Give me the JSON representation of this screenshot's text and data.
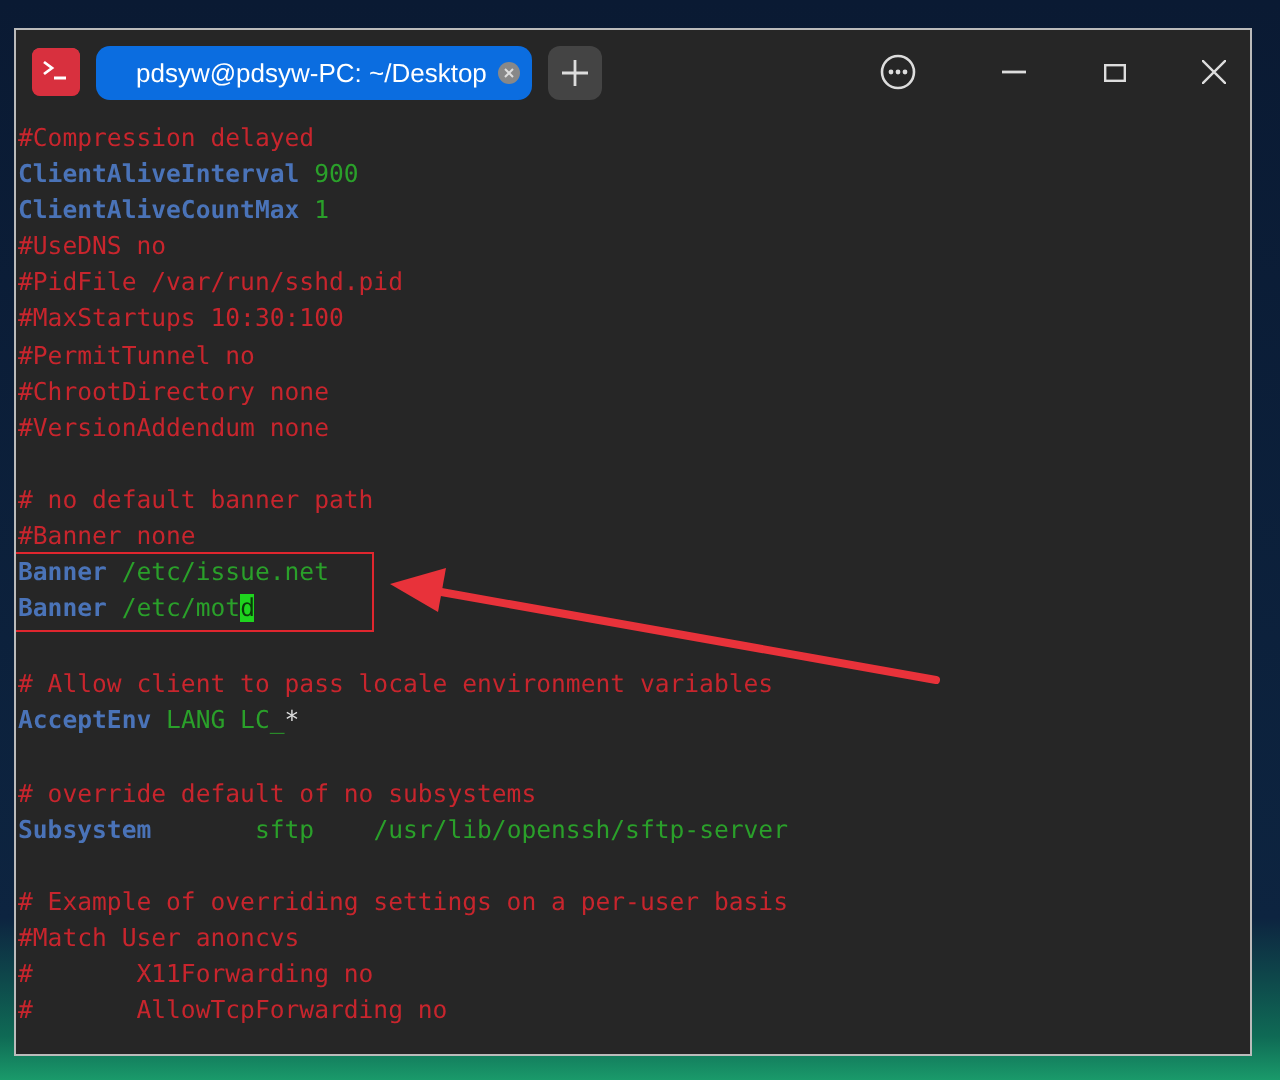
{
  "window": {
    "tabs": [
      {
        "label": "pdsyw@pdsyw-PC: ~/Desktop",
        "selected": true
      }
    ]
  },
  "terminal": {
    "lines_before": [
      {
        "kind": "code",
        "segments": [
          {
            "kind": "comment",
            "text": "#Compression delayed"
          }
        ]
      },
      {
        "kind": "code",
        "segments": [
          {
            "kind": "keyword",
            "text": "ClientAliveInterval"
          },
          {
            "kind": "value",
            "text": " 900"
          }
        ]
      },
      {
        "kind": "code",
        "segments": [
          {
            "kind": "keyword",
            "text": "ClientAliveCountMax"
          },
          {
            "kind": "value",
            "text": " 1"
          }
        ]
      },
      {
        "kind": "code",
        "segments": [
          {
            "kind": "comment",
            "text": "#UseDNS no"
          }
        ]
      },
      {
        "kind": "code",
        "segments": [
          {
            "kind": "comment",
            "text": "#PidFile /var/run/sshd.pid"
          }
        ]
      },
      {
        "kind": "code",
        "segments": [
          {
            "kind": "comment",
            "text": "#MaxStartups 10:30:100"
          }
        ]
      },
      {
        "kind": "code",
        "segments": [
          {
            "kind": "comment",
            "text": "#PermitTunnel no"
          }
        ]
      },
      {
        "kind": "code",
        "segments": [
          {
            "kind": "comment",
            "text": "#ChrootDirectory none"
          }
        ]
      },
      {
        "kind": "code",
        "segments": [
          {
            "kind": "comment",
            "text": "#VersionAddendum none"
          }
        ]
      },
      {
        "kind": "blank"
      },
      {
        "kind": "code",
        "segments": [
          {
            "kind": "comment",
            "text": "# no default banner path"
          }
        ]
      },
      {
        "kind": "code",
        "segments": [
          {
            "kind": "comment",
            "text": "#Banner none"
          }
        ]
      }
    ],
    "highlighted_lines": [
      {
        "kind": "code",
        "segments": [
          {
            "kind": "keyword",
            "text": "Banner"
          },
          {
            "kind": "value",
            "text": " /etc/issue.net"
          }
        ]
      },
      {
        "kind": "code",
        "segments": [
          {
            "kind": "keyword",
            "text": "Banner"
          },
          {
            "kind": "value",
            "text": " /etc/mot"
          },
          {
            "kind": "cursor",
            "text": "d"
          }
        ]
      }
    ],
    "lines_after": [
      {
        "kind": "blank"
      },
      {
        "kind": "code",
        "segments": [
          {
            "kind": "comment",
            "text": "# Allow client to pass locale environment variables"
          }
        ]
      },
      {
        "kind": "code",
        "segments": [
          {
            "kind": "keyword",
            "text": "AcceptEnv"
          },
          {
            "kind": "value",
            "text": " LANG LC_"
          },
          {
            "kind": "plain",
            "text": "*"
          }
        ]
      },
      {
        "kind": "blank"
      },
      {
        "kind": "code",
        "segments": [
          {
            "kind": "comment",
            "text": "# override default of no subsystems"
          }
        ]
      },
      {
        "kind": "code",
        "segments": [
          {
            "kind": "keyword",
            "text": "Subsystem"
          },
          {
            "kind": "value",
            "text": "       sftp    /usr/lib/openssh/sftp-server"
          }
        ]
      },
      {
        "kind": "blank"
      },
      {
        "kind": "code",
        "segments": [
          {
            "kind": "comment",
            "text": "# Example of overriding settings on a per-user basis"
          }
        ]
      },
      {
        "kind": "code",
        "segments": [
          {
            "kind": "comment",
            "text": "#Match User anoncvs"
          }
        ]
      },
      {
        "kind": "code",
        "segments": [
          {
            "kind": "comment",
            "text": "#       X11Forwarding no"
          }
        ]
      },
      {
        "kind": "code",
        "segments": [
          {
            "kind": "comment",
            "text": "#       AllowTcpForwarding no"
          }
        ]
      }
    ]
  }
}
